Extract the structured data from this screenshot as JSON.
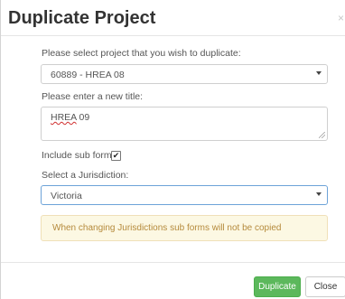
{
  "dialog": {
    "title": "Duplicate Project",
    "close_glyph": "×"
  },
  "form": {
    "project_label": "Please select project that you wish to duplicate:",
    "project_value": "60889 - HREA 08",
    "title_label": "Please enter a new title:",
    "title_value_misspelled": "HREA",
    "title_value_rest": " 09",
    "subforms_label": "Include sub forms:",
    "subforms_checked": true,
    "subforms_check_glyph": "✔",
    "jurisdiction_label": "Select a Jurisdiction:",
    "jurisdiction_value": "Victoria"
  },
  "alert": {
    "text": "When changing Jurisdictions sub forms will not be copied"
  },
  "footer": {
    "duplicate_label": "Duplicate",
    "close_label": "Close"
  },
  "colors": {
    "primary_green": "#5cb85c",
    "alert_bg": "#fcf8e3",
    "alert_text": "#b58a3c",
    "focus_border": "#6da3d8"
  },
  "icons": {
    "close": "close-icon",
    "dropdown": "chevron-down-icon",
    "checkbox": "checkbox-icon",
    "resize": "resize-handle-icon"
  }
}
